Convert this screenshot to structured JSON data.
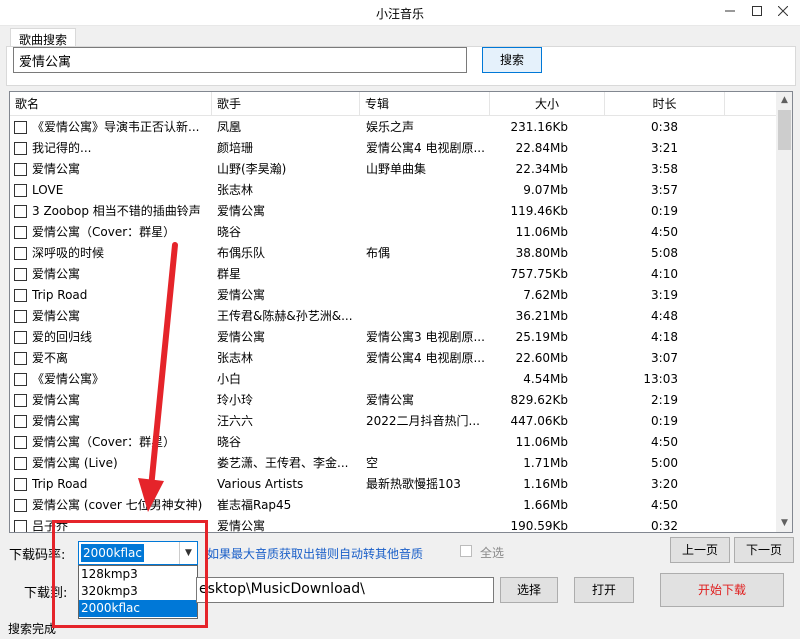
{
  "window": {
    "title": "小汪音乐"
  },
  "tabs": [
    {
      "label": "歌曲搜索"
    }
  ],
  "search": {
    "value": "爱情公寓",
    "button_label": "搜索"
  },
  "table": {
    "columns": [
      "歌名",
      "歌手",
      "专辑",
      "大小",
      "时长"
    ],
    "rows": [
      {
        "name": "《爱情公寓》导演韦正否认新...",
        "artist": "凤凰",
        "album": "娱乐之声",
        "size": "231.16Kb",
        "time": "0:38"
      },
      {
        "name": "我记得的...",
        "artist": "颜培珊",
        "album": "爱情公寓4 电视剧原...",
        "size": "22.84Mb",
        "time": "3:21"
      },
      {
        "name": "爱情公寓",
        "artist": "山野(李昊瀚)",
        "album": "山野单曲集",
        "size": "22.34Mb",
        "time": "3:58"
      },
      {
        "name": "LOVE",
        "artist": "张志林",
        "album": "",
        "size": "9.07Mb",
        "time": "3:57"
      },
      {
        "name": "3 Zoobop 相当不错的插曲铃声",
        "artist": "爱情公寓",
        "album": "",
        "size": "119.46Kb",
        "time": "0:19"
      },
      {
        "name": "爱情公寓（Cover：群星）",
        "artist": "晓谷",
        "album": "",
        "size": "11.06Mb",
        "time": "4:50"
      },
      {
        "name": "深呼吸的时候",
        "artist": "布偶乐队",
        "album": "布偶",
        "size": "38.80Mb",
        "time": "5:08"
      },
      {
        "name": "爱情公寓",
        "artist": "群星",
        "album": "",
        "size": "757.75Kb",
        "time": "4:10"
      },
      {
        "name": "Trip Road",
        "artist": "爱情公寓",
        "album": "",
        "size": "7.62Mb",
        "time": "3:19"
      },
      {
        "name": "爱情公寓",
        "artist": "王传君&陈赫&孙艺洲&...",
        "album": "",
        "size": "36.21Mb",
        "time": "4:48"
      },
      {
        "name": "爱的回归线",
        "artist": "爱情公寓",
        "album": "爱情公寓3 电视剧原...",
        "size": "25.19Mb",
        "time": "4:18"
      },
      {
        "name": "爱不离",
        "artist": "张志林",
        "album": "爱情公寓4 电视剧原...",
        "size": "22.60Mb",
        "time": "3:07"
      },
      {
        "name": "《爱情公寓》",
        "artist": "小白",
        "album": "",
        "size": "4.54Mb",
        "time": "13:03"
      },
      {
        "name": "爱情公寓",
        "artist": "玲小玲",
        "album": "爱情公寓",
        "size": "829.62Kb",
        "time": "2:19"
      },
      {
        "name": "爱情公寓",
        "artist": "汪六六",
        "album": "2022二月抖音热门...",
        "size": "447.06Kb",
        "time": "0:19"
      },
      {
        "name": "爱情公寓（Cover：群星）",
        "artist": "晓谷",
        "album": "",
        "size": "11.06Mb",
        "time": "4:50"
      },
      {
        "name": "爱情公寓 (Live)",
        "artist": "娄艺潇、王传君、李金...",
        "album": "空",
        "size": "1.71Mb",
        "time": "5:00"
      },
      {
        "name": "Trip Road",
        "artist": "Various Artists",
        "album": "最新热歌慢摇103",
        "size": "1.16Mb",
        "time": "3:20"
      },
      {
        "name": "爱情公寓 (cover 七位男神女神)",
        "artist": "崔志福Rap45",
        "album": "",
        "size": "1.66Mb",
        "time": "4:50"
      },
      {
        "name": "吕子乔",
        "artist": "爱情公寓",
        "album": "",
        "size": "190.59Kb",
        "time": "0:32"
      }
    ]
  },
  "download": {
    "bitrate_label": "下载码率:",
    "bitrate_selected": "2000kflac",
    "bitrate_options": [
      "128kmp3",
      "320kmp3",
      "2000kflac"
    ],
    "hint": "如果最大音质获取出错则自动转其他音质",
    "select_all_label": "全选",
    "prev_label": "上一页",
    "next_label": "下一页",
    "path_label": "下载到:",
    "path_value": "esktop\\MusicDownload\\",
    "choose_label": "选择",
    "open_label": "打开",
    "start_label": "开始下载"
  },
  "status": {
    "text": "搜索完成"
  },
  "colors": {
    "accent": "#0078d7",
    "annotation": "#e5242a",
    "link": "#1a5fc8",
    "start_text": "#e01c1c"
  },
  "icons": {
    "minimize": "minimize-icon",
    "maximize": "maximize-icon",
    "close": "close-icon",
    "dropdown": "chevron-down-icon"
  }
}
